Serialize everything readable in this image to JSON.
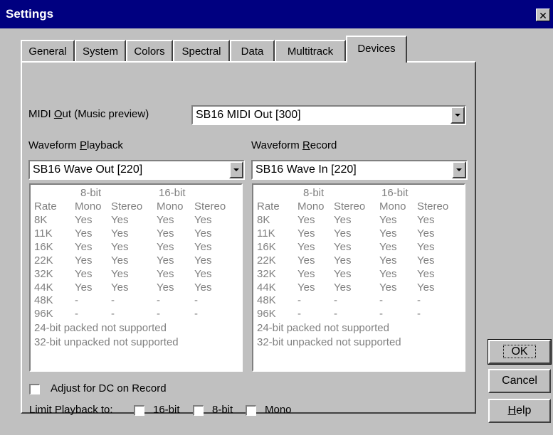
{
  "window": {
    "title": "Settings",
    "close_glyph": "✕"
  },
  "tabs": [
    {
      "label": "General"
    },
    {
      "label": "System"
    },
    {
      "label": "Colors"
    },
    {
      "label": "Spectral"
    },
    {
      "label": "Data"
    },
    {
      "label": "Multitrack"
    },
    {
      "label": "Devices",
      "active": true
    }
  ],
  "midi": {
    "label_pre": "MIDI ",
    "label_accel": "O",
    "label_post": "ut (Music preview)",
    "value": "SB16 MIDI Out [300]"
  },
  "playback": {
    "label_pre": "Waveform ",
    "label_accel": "P",
    "label_post": "layback",
    "device": "SB16 Wave Out [220]"
  },
  "record": {
    "label_pre": "Waveform ",
    "label_accel": "R",
    "label_post": "ecord",
    "device": "SB16 Wave In [220]"
  },
  "capabilities": {
    "group_headers": [
      "8-bit",
      "16-bit"
    ],
    "columns": [
      "Rate",
      "Mono",
      "Stereo",
      "Mono",
      "Stereo"
    ],
    "rows": [
      [
        "8K",
        "Yes",
        "Yes",
        "Yes",
        "Yes"
      ],
      [
        "11K",
        "Yes",
        "Yes",
        "Yes",
        "Yes"
      ],
      [
        "16K",
        "Yes",
        "Yes",
        "Yes",
        "Yes"
      ],
      [
        "22K",
        "Yes",
        "Yes",
        "Yes",
        "Yes"
      ],
      [
        "32K",
        "Yes",
        "Yes",
        "Yes",
        "Yes"
      ],
      [
        "44K",
        "Yes",
        "Yes",
        "Yes",
        "Yes"
      ],
      [
        "48K",
        "-",
        "-",
        "-",
        "-"
      ],
      [
        "96K",
        "-",
        "-",
        "-",
        "-"
      ]
    ],
    "notes": [
      "24-bit packed not supported",
      "32-bit unpacked not supported"
    ]
  },
  "options": {
    "adjust_dc": {
      "label": "Adjust for DC on Record",
      "checked": false
    },
    "limit_label": "Limit Playback to:",
    "limit": [
      {
        "label": "16-bit",
        "checked": false
      },
      {
        "label": "8-bit",
        "checked": false
      },
      {
        "label": "Mono",
        "checked": false
      }
    ]
  },
  "buttons": {
    "ok": "OK",
    "cancel": "Cancel",
    "help_accel": "H",
    "help_rest": "elp"
  }
}
